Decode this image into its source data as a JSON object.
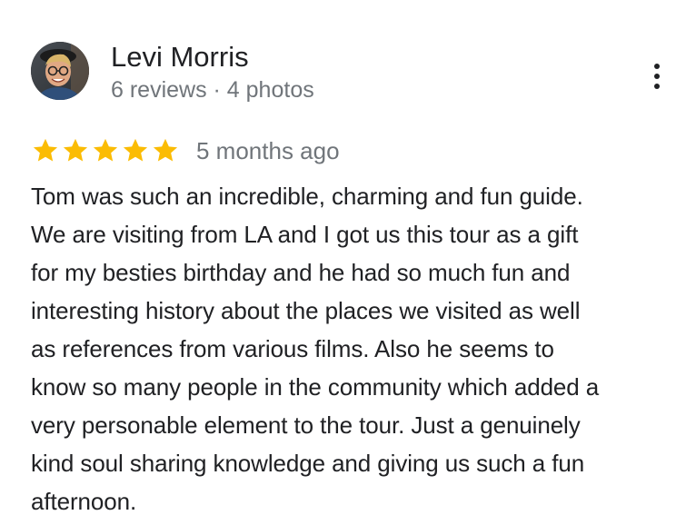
{
  "reviewer": {
    "name": "Levi Morris",
    "meta": "6 reviews · 4 photos"
  },
  "rating": {
    "stars": 5,
    "max_stars": 5,
    "star_color": "#fbbc04",
    "date": "5 months ago"
  },
  "review": {
    "text": "Tom was such an incredible, charming and fun guide.\nWe are visiting from LA and I got us this tour as a gift\nfor my besties birthday and he had so much fun and\ninteresting history about the places we visited as well\nas references from various films.  Also he seems to\nknow so many people in the community which added a\nvery personable element to the tour. Just a genuinely\nkind soul sharing knowledge and giving us such a fun\nafternoon."
  },
  "icons": {
    "more": "more-vert-icon",
    "star": "star-icon",
    "avatar": "profile-photo"
  }
}
